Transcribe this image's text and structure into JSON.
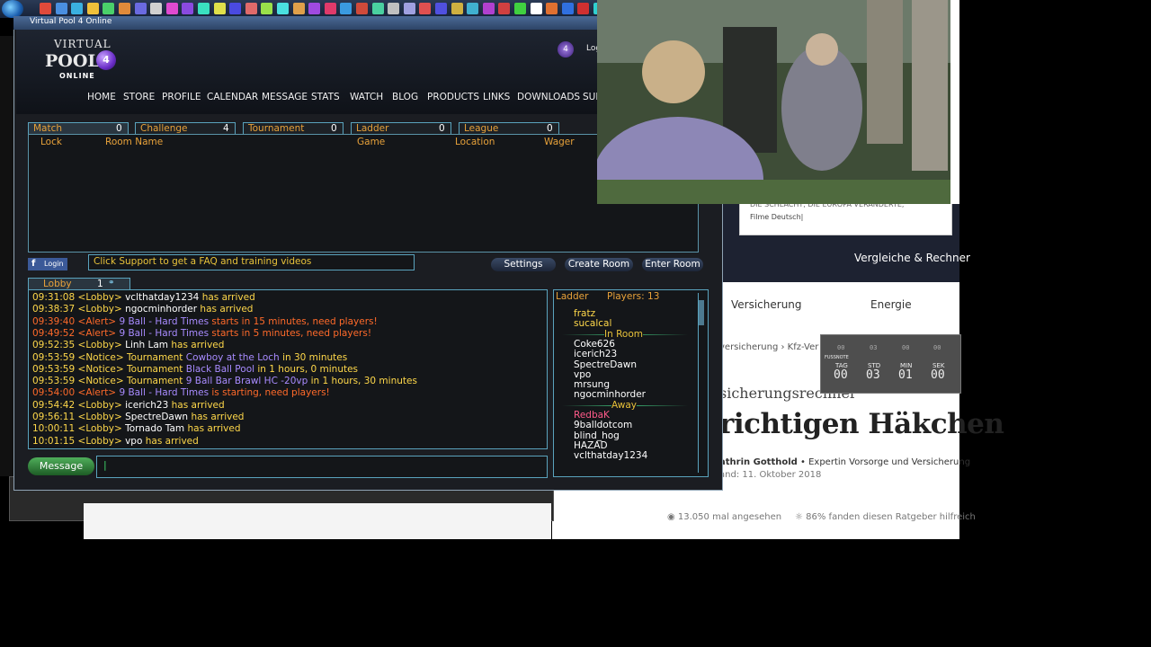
{
  "window_title": "Virtual Pool 4 Online",
  "logo": {
    "line1": "VIRTUAL",
    "line2": "POOL",
    "line3": "ONLINE",
    "ball": "4"
  },
  "login_short": "Log",
  "nav": [
    "HOME",
    "STORE",
    "PROFILE",
    "CALENDAR",
    "MESSAGE",
    "STATS",
    "WATCH",
    "BLOG",
    "PRODUCTS",
    "LINKS",
    "DOWNLOADS",
    "SUP"
  ],
  "room_tabs": [
    {
      "label": "Match",
      "count": "0"
    },
    {
      "label": "Challenge",
      "count": "4"
    },
    {
      "label": "Tournament",
      "count": "0"
    },
    {
      "label": "Ladder",
      "count": "0"
    },
    {
      "label": "League",
      "count": "0"
    }
  ],
  "room_columns": [
    "Lock",
    "Room Name",
    "Game",
    "Location",
    "Wager"
  ],
  "facebook_login": "Login",
  "notice": "Click Support to get a FAQ and training videos",
  "buttons": {
    "settings": "Settings",
    "create_room": "Create Room",
    "enter_room": "Enter Room",
    "message": "Message"
  },
  "lobby_tab": {
    "label": "Lobby",
    "count": "1"
  },
  "chat": [
    {
      "time": "09:31:08",
      "tag": "<Lobby>",
      "name": "vclthatday1234",
      "text": "has arrived",
      "kind": "lobby"
    },
    {
      "time": "09:38:37",
      "tag": "<Lobby>",
      "name": "ngocminhorder",
      "text": "has arrived",
      "kind": "lobby"
    },
    {
      "time": "09:39:40",
      "tag": "<Alert>",
      "name": "9 Ball - Hard Times",
      "text": "starts in 15 minutes, need players!",
      "kind": "alert"
    },
    {
      "time": "09:49:52",
      "tag": "<Alert>",
      "name": "9 Ball - Hard Times",
      "text": "starts in 5 minutes, need players!",
      "kind": "alert"
    },
    {
      "time": "09:52:35",
      "tag": "<Lobby>",
      "name": "Linh Lam",
      "text": "has arrived",
      "kind": "lobby"
    },
    {
      "time": "09:53:59",
      "tag": "<Notice>",
      "pre": "Tournament",
      "name": "Cowboy at the Loch",
      "text": "in 30 minutes",
      "kind": "notice"
    },
    {
      "time": "09:53:59",
      "tag": "<Notice>",
      "pre": "Tournament",
      "name": "Black Ball Pool",
      "text": "in 1 hours, 0 minutes",
      "kind": "notice"
    },
    {
      "time": "09:53:59",
      "tag": "<Notice>",
      "pre": "Tournament",
      "name": "9 Ball Bar Brawl HC -20vp",
      "text": "in 1 hours, 30 minutes",
      "kind": "notice"
    },
    {
      "time": "09:54:00",
      "tag": "<Alert>",
      "name": "9 Ball - Hard Times",
      "text": "is starting, need players!",
      "kind": "alert"
    },
    {
      "time": "09:54:42",
      "tag": "<Lobby>",
      "name": "icerich23",
      "text": "has arrived",
      "kind": "lobby"
    },
    {
      "time": "09:56:11",
      "tag": "<Lobby>",
      "name": "SpectreDawn",
      "text": "has arrived",
      "kind": "lobby"
    },
    {
      "time": "10:00:11",
      "tag": "<Lobby>",
      "name": "Tornado Tam",
      "text": "has arrived",
      "kind": "lobby"
    },
    {
      "time": "10:01:15",
      "tag": "<Lobby>",
      "name": "vpo",
      "text": "has arrived",
      "kind": "lobby"
    }
  ],
  "ladder": {
    "header": "Ladder",
    "players_label": "Players: 13",
    "top": [
      {
        "name": "fratz",
        "color": "#ffd84a"
      },
      {
        "name": "sucalcal",
        "color": "#ffd84a"
      }
    ],
    "in_room_label": "In Room",
    "in_room": [
      "Coke626",
      "icerich23",
      "SpectreDawn",
      "vpo",
      "mrsung",
      "ngocminhorder"
    ],
    "away_label": "Away",
    "away": [
      {
        "name": "RedbaK",
        "color": "#ff5a8a"
      },
      {
        "name": "9balldotcom",
        "color": "#ffffff"
      },
      {
        "name": "blind_hog",
        "color": "#ffffff"
      },
      {
        "name": "HAZAD",
        "color": "#ffffff"
      },
      {
        "name": "vclthatday1234",
        "color": "#ffffff"
      }
    ]
  },
  "web": {
    "header_title": "Vergleiche & Rechner",
    "nav1": "Versicherung",
    "nav2": "Energie",
    "crumb1": "versicherung",
    "crumb2": "Kfz-Ver",
    "h1a": "sicherungsrechner",
    "h1b": "richtigen Häkchen",
    "author": "athrin Gotthold",
    "author_role": "Expertin Vorsorge und Versicherung",
    "stand": "and: 11. Oktober 2018",
    "views": "13.050 mal angesehen",
    "helpful": "86% fanden diesen Ratgeber hilfreich",
    "card_line1": "DIE SCHLACHT, DIE EUROPA VERÄNDERTE,",
    "card_line2": "Filme Deutsch|"
  },
  "countdown": {
    "labels": [
      "TAG",
      "STD",
      "MIN",
      "SEK"
    ],
    "values": [
      "00",
      "03",
      "01",
      "00"
    ],
    "small_values": [
      "00",
      "03",
      "00",
      "00"
    ],
    "tag": "FUSSNOTE"
  },
  "colors": {
    "accent_orange": "#e8a23a",
    "chat_yellow": "#ffd84a",
    "alert": "#ff6a2a",
    "notice_purple": "#a88bff",
    "frame": "#5aa3bd"
  }
}
